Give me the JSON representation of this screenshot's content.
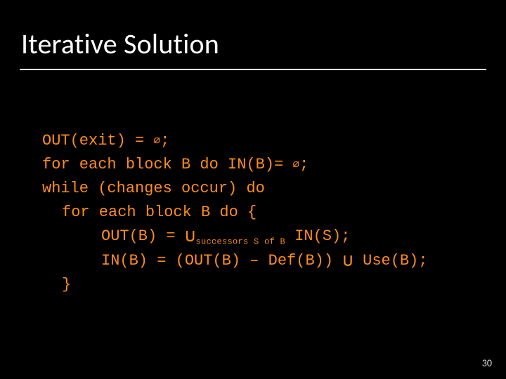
{
  "title": "Iterative Solution",
  "code": {
    "l1_a": "OUT(exit) = ",
    "l1_empty": "∅",
    "l1_b": ";",
    "l2_a": "for each block B do IN(B)= ",
    "l2_empty": "∅",
    "l2_b": ";",
    "l3": "while (changes occur) do",
    "l4": "for each block B do {",
    "l5_a": "OUT(B) = ",
    "l5_union": "∪",
    "l5_sub": "successors S of B",
    "l5_b": " IN(S);",
    "l6_a": "IN(B) = (OUT(B) – Def(B)) ",
    "l6_union": "∪",
    "l6_b": " Use(B);",
    "l7": "}"
  },
  "page_number": "30"
}
